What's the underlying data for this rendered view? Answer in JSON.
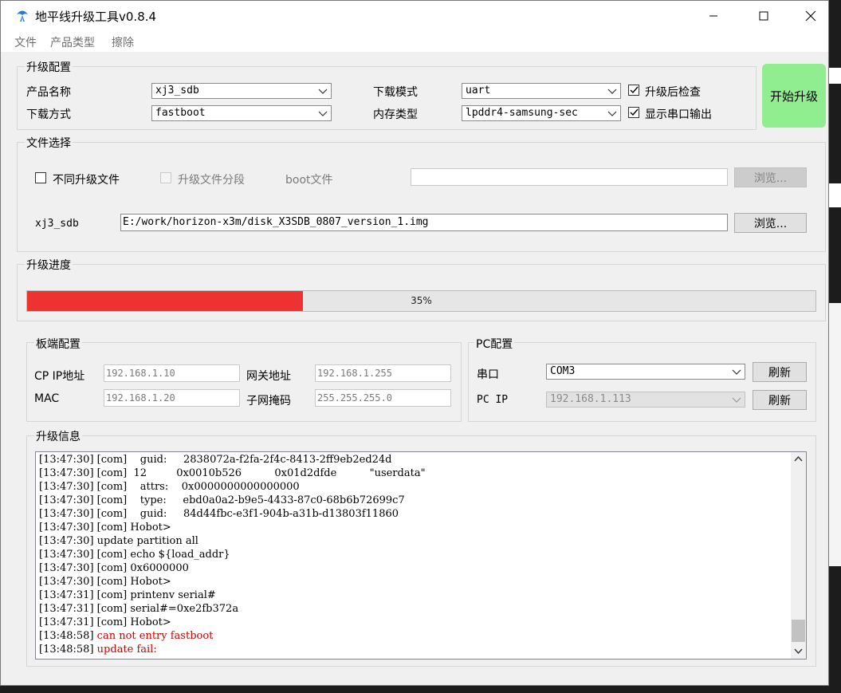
{
  "window": {
    "title": "地平线升级工具v0.8.4"
  },
  "menu": {
    "items": [
      "文件",
      "产品类型",
      "擦除"
    ]
  },
  "upgrade_config": {
    "title": "升级配置",
    "product_name_label": "产品名称",
    "product_name_value": "xj3_sdb",
    "download_method_label": "下载方式",
    "download_method_value": "fastboot",
    "download_mode_label": "下载模式",
    "download_mode_value": "uart",
    "memory_type_label": "内存类型",
    "memory_type_value": "lpddr4-samsung-sec",
    "check_after_label": "升级后检查",
    "check_after_checked": true,
    "show_serial_label": "显示串口输出",
    "show_serial_checked": true,
    "start_button": "开始升级"
  },
  "file_select": {
    "title": "文件选择",
    "different_files_label": "不同升级文件",
    "different_files_checked": false,
    "segmented_label": "升级文件分段",
    "boot_label": "boot文件",
    "boot_path": "",
    "browse_disabled_label": "浏览...",
    "image_label": "xj3_sdb",
    "image_path": "E:/work/horizon-x3m/disk_X3SDB_0807_version_1.img",
    "browse_label": "浏览..."
  },
  "progress": {
    "title": "升级进度",
    "value": 0.35,
    "text": "35%"
  },
  "board_config": {
    "title": "板端配置",
    "cp_ip_label": "CP IP地址",
    "cp_ip_value": "192.168.1.10",
    "gateway_label": "网关地址",
    "gateway_value": "192.168.1.255",
    "mac_label": "MAC",
    "mac_value": "192.168.1.20",
    "netmask_label": "子网掩码",
    "netmask_value": "255.255.255.0"
  },
  "pc_config": {
    "title": "PC配置",
    "serial_label": "串口",
    "serial_value": "COM3",
    "refresh1": "刷新",
    "pc_ip_label": "PC IP",
    "pc_ip_value": "192.168.1.113",
    "refresh2": "刷新"
  },
  "upgrade_info": {
    "title": "升级信息",
    "lines": [
      {
        "text": "[13:47:30] [com]    guid:     2838072a-f2fa-2f4c-8413-2ff9eb2ed24d",
        "error": false
      },
      {
        "text": "[13:47:30] [com]  12         0x0010b526          0x01d2dfde          \"userdata\"",
        "error": false
      },
      {
        "text": "[13:47:30] [com]    attrs:    0x0000000000000000",
        "error": false
      },
      {
        "text": "[13:47:30] [com]    type:     ebd0a0a2-b9e5-4433-87c0-68b6b72699c7",
        "error": false
      },
      {
        "text": "[13:47:30] [com]    guid:     84d44fbc-e3f1-904b-a31b-d13803f11860",
        "error": false
      },
      {
        "text": "[13:47:30] [com] Hobot>",
        "error": false
      },
      {
        "text": "[13:47:30] update partition all",
        "error": false
      },
      {
        "text": "[13:47:30] [com] echo ${load_addr}",
        "error": false
      },
      {
        "text": "[13:47:30] [com] 0x6000000",
        "error": false
      },
      {
        "text": "[13:47:30] [com] Hobot>",
        "error": false
      },
      {
        "text": "[13:47:31] [com] printenv serial#",
        "error": false
      },
      {
        "text": "[13:47:31] [com] serial#=0xe2fb372a",
        "error": false
      },
      {
        "text": "[13:47:31] [com] Hobot>",
        "error": false
      },
      {
        "text": "[13:48:58] can not entry fastboot",
        "error": true
      },
      {
        "text": "[13:48:58] update fail:",
        "error": true
      }
    ]
  }
}
